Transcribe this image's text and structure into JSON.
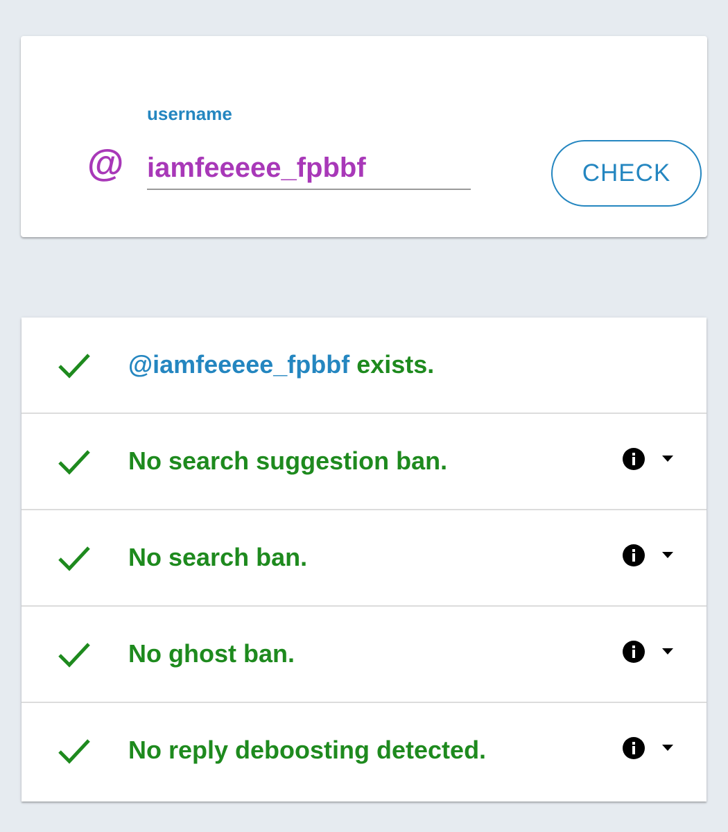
{
  "search": {
    "label": "username",
    "at_symbol": "@",
    "value": "iamfeeeee_fpbbf",
    "button_label": "CHECK"
  },
  "results": [
    {
      "username": "@iamfeeeee_fpbbf",
      "text": " exists.",
      "status_icon": "check-icon",
      "has_info": false
    },
    {
      "text": "No search suggestion ban.",
      "status_icon": "check-icon",
      "has_info": true,
      "info_icon": "info-icon",
      "toggle_icon": "caret-down-icon"
    },
    {
      "text": "No search ban.",
      "status_icon": "check-icon",
      "has_info": true,
      "info_icon": "info-icon",
      "toggle_icon": "caret-down-icon"
    },
    {
      "text": "No ghost ban.",
      "status_icon": "check-icon",
      "has_info": true,
      "info_icon": "info-icon",
      "toggle_icon": "caret-down-icon"
    },
    {
      "text": "No reply deboosting detected.",
      "status_icon": "check-icon",
      "has_info": true,
      "info_icon": "info-icon",
      "toggle_icon": "caret-down-icon"
    }
  ],
  "colors": {
    "accent_blue": "#2486c0",
    "accent_purple": "#a838b8",
    "success_green": "#1e8a1e",
    "background": "#e6ebf0"
  }
}
